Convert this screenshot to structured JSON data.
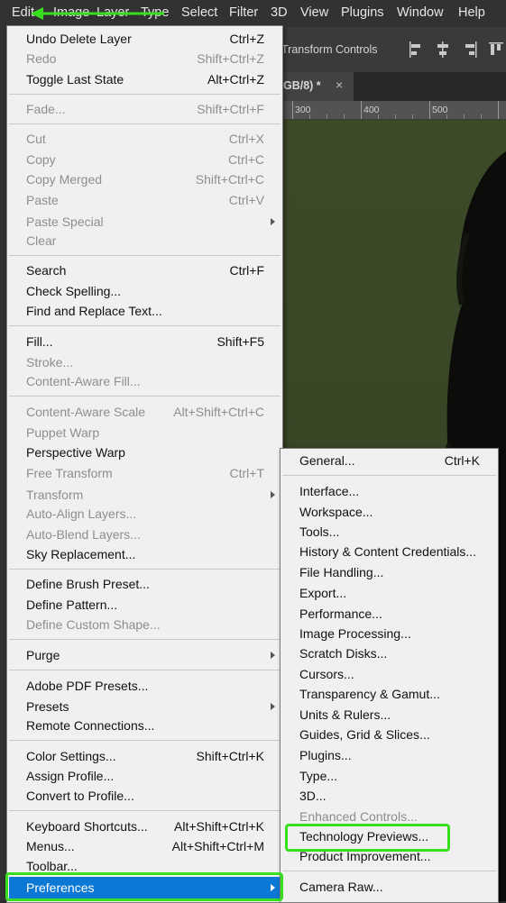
{
  "menubar": [
    "Edit",
    "Image",
    "Layer",
    "Type",
    "Select",
    "Filter",
    "3D",
    "View",
    "Plugins",
    "Window",
    "Help"
  ],
  "options_bar": {
    "transform_label": "Transform Controls"
  },
  "doc_tab": {
    "title": "GB/8) *",
    "close": "×"
  },
  "ruler_labels": [
    "300",
    "400",
    "500"
  ],
  "edit_menu": {
    "undo": {
      "label": "Undo Delete Layer",
      "shortcut": "Ctrl+Z"
    },
    "redo": {
      "label": "Redo",
      "shortcut": "Shift+Ctrl+Z"
    },
    "toggle": {
      "label": "Toggle Last State",
      "shortcut": "Alt+Ctrl+Z"
    },
    "fade": {
      "label": "Fade...",
      "shortcut": "Shift+Ctrl+F"
    },
    "cut": {
      "label": "Cut",
      "shortcut": "Ctrl+X"
    },
    "copy": {
      "label": "Copy",
      "shortcut": "Ctrl+C"
    },
    "copy_merged": {
      "label": "Copy Merged",
      "shortcut": "Shift+Ctrl+C"
    },
    "paste": {
      "label": "Paste",
      "shortcut": "Ctrl+V"
    },
    "paste_special": {
      "label": "Paste Special"
    },
    "clear": {
      "label": "Clear"
    },
    "search": {
      "label": "Search",
      "shortcut": "Ctrl+F"
    },
    "check_spelling": {
      "label": "Check Spelling..."
    },
    "find_replace": {
      "label": "Find and Replace Text..."
    },
    "fill": {
      "label": "Fill...",
      "shortcut": "Shift+F5"
    },
    "stroke": {
      "label": "Stroke..."
    },
    "caf": {
      "label": "Content-Aware Fill..."
    },
    "cas": {
      "label": "Content-Aware Scale",
      "shortcut": "Alt+Shift+Ctrl+C"
    },
    "puppet": {
      "label": "Puppet Warp"
    },
    "perspective": {
      "label": "Perspective Warp"
    },
    "free_transform": {
      "label": "Free Transform",
      "shortcut": "Ctrl+T"
    },
    "transform": {
      "label": "Transform"
    },
    "auto_align": {
      "label": "Auto-Align Layers..."
    },
    "auto_blend": {
      "label": "Auto-Blend Layers..."
    },
    "sky": {
      "label": "Sky Replacement..."
    },
    "brush_preset": {
      "label": "Define Brush Preset..."
    },
    "pattern": {
      "label": "Define Pattern..."
    },
    "custom_shape": {
      "label": "Define Custom Shape..."
    },
    "purge": {
      "label": "Purge"
    },
    "pdf_presets": {
      "label": "Adobe PDF Presets..."
    },
    "presets": {
      "label": "Presets"
    },
    "remote": {
      "label": "Remote Connections..."
    },
    "color_settings": {
      "label": "Color Settings...",
      "shortcut": "Shift+Ctrl+K"
    },
    "assign_profile": {
      "label": "Assign Profile..."
    },
    "convert_profile": {
      "label": "Convert to Profile..."
    },
    "keyboard": {
      "label": "Keyboard Shortcuts...",
      "shortcut": "Alt+Shift+Ctrl+K"
    },
    "menus": {
      "label": "Menus...",
      "shortcut": "Alt+Shift+Ctrl+M"
    },
    "toolbar": {
      "label": "Toolbar..."
    },
    "preferences": {
      "label": "Preferences"
    }
  },
  "prefs_menu": {
    "general": {
      "label": "General...",
      "shortcut": "Ctrl+K"
    },
    "interface": {
      "label": "Interface..."
    },
    "workspace": {
      "label": "Workspace..."
    },
    "tools": {
      "label": "Tools..."
    },
    "history": {
      "label": "History & Content Credentials..."
    },
    "file_handling": {
      "label": "File Handling..."
    },
    "export": {
      "label": "Export..."
    },
    "performance": {
      "label": "Performance..."
    },
    "image_processing": {
      "label": "Image Processing..."
    },
    "scratch": {
      "label": "Scratch Disks..."
    },
    "cursors": {
      "label": "Cursors..."
    },
    "transparency": {
      "label": "Transparency & Gamut..."
    },
    "units": {
      "label": "Units & Rulers..."
    },
    "guides": {
      "label": "Guides, Grid & Slices..."
    },
    "plugins": {
      "label": "Plugins..."
    },
    "type": {
      "label": "Type..."
    },
    "three_d": {
      "label": "3D..."
    },
    "enhanced": {
      "label": "Enhanced Controls..."
    },
    "tech_previews": {
      "label": "Technology Previews..."
    },
    "product_improvement": {
      "label": "Product Improvement..."
    },
    "camera_raw": {
      "label": "Camera Raw..."
    }
  },
  "colors": {
    "highlight": "#0a78d4",
    "annotation_green": "#36e01c",
    "menu_bg": "#f0f0f0"
  }
}
